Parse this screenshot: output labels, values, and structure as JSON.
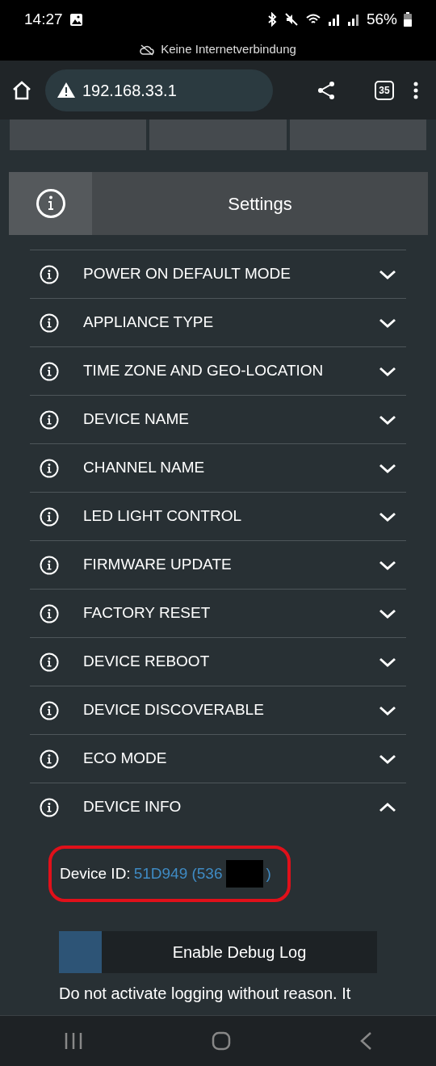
{
  "status_bar": {
    "time": "14:27",
    "battery": "56%",
    "notice": "Keine Internetverbindung"
  },
  "browser": {
    "url": "192.168.33.1",
    "tab_count": "35"
  },
  "top_tiles": [
    {
      "kind": "tile"
    },
    {
      "kind": "tile"
    },
    {
      "kind": "tile"
    }
  ],
  "section": {
    "title": "Settings"
  },
  "items": [
    {
      "label": "POWER ON DEFAULT MODE",
      "expanded": false
    },
    {
      "label": "APPLIANCE TYPE",
      "expanded": false
    },
    {
      "label": "TIME ZONE AND GEO-LOCATION",
      "expanded": false
    },
    {
      "label": "DEVICE NAME",
      "expanded": false
    },
    {
      "label": "CHANNEL NAME",
      "expanded": false
    },
    {
      "label": "LED LIGHT CONTROL",
      "expanded": false
    },
    {
      "label": "FIRMWARE UPDATE",
      "expanded": false
    },
    {
      "label": "FACTORY RESET",
      "expanded": false
    },
    {
      "label": "DEVICE REBOOT",
      "expanded": false
    },
    {
      "label": "DEVICE DISCOVERABLE",
      "expanded": false
    },
    {
      "label": "ECO MODE",
      "expanded": false
    },
    {
      "label": "DEVICE INFO",
      "expanded": true
    }
  ],
  "device_info": {
    "label": "Device ID:",
    "value": "51D949 (536",
    "value_end": ")",
    "debug_button": "Enable Debug Log",
    "note": "Do not activate logging without reason. It"
  }
}
